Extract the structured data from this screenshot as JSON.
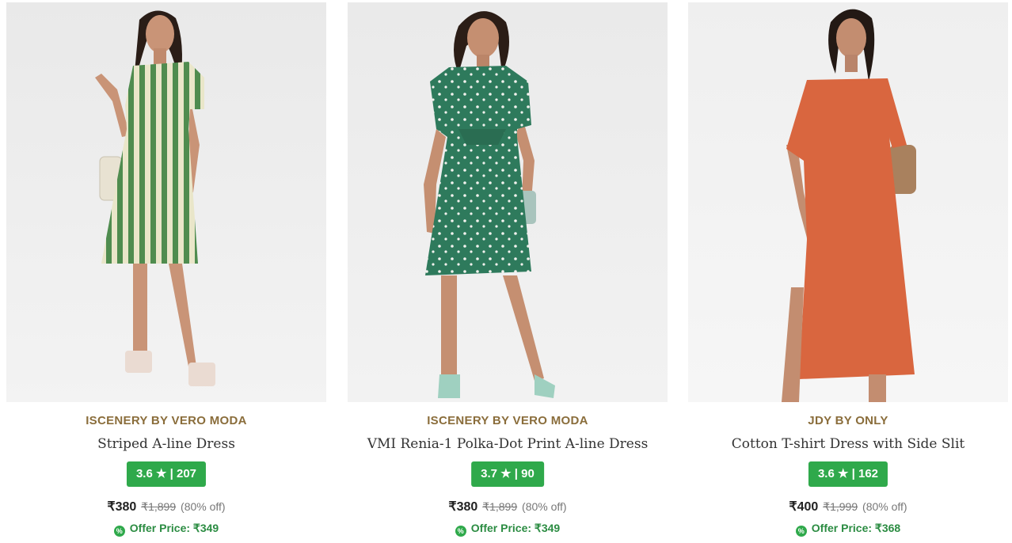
{
  "products": [
    {
      "brand": "ISCENERY BY VERO MODA",
      "name": "Striped A-line Dress",
      "rating": "3.6",
      "star": "★",
      "separator": "|",
      "reviews": "207",
      "price": "₹380",
      "mrp": "₹1,899",
      "discount": "(80% off)",
      "offer_label": "Offer Price: ₹349",
      "dress_color": "#4f8c4f",
      "stripe_color": "#e9e6c9"
    },
    {
      "brand": "ISCENERY BY VERO MODA",
      "name": "VMI Renia-1 Polka-Dot Print A-line Dress",
      "rating": "3.7",
      "star": "★",
      "separator": "|",
      "reviews": "90",
      "price": "₹380",
      "mrp": "₹1,899",
      "discount": "(80% off)",
      "offer_label": "Offer Price: ₹349",
      "dress_color": "#2e7a5c",
      "dot_color": "#f2f2ee"
    },
    {
      "brand": "JDY BY ONLY",
      "name": "Cotton T-shirt Dress with Side Slit",
      "rating": "3.6",
      "star": "★",
      "separator": "|",
      "reviews": "162",
      "price": "₹400",
      "mrp": "₹1,999",
      "discount": "(80% off)",
      "offer_label": "Offer Price: ₹368",
      "dress_color": "#d9663f"
    }
  ],
  "offer_icon": "percent-badge-icon",
  "colors": {
    "rating_bg": "#2fa94b",
    "brand_text": "#8a6d3b",
    "offer_text": "#2b8c42"
  }
}
